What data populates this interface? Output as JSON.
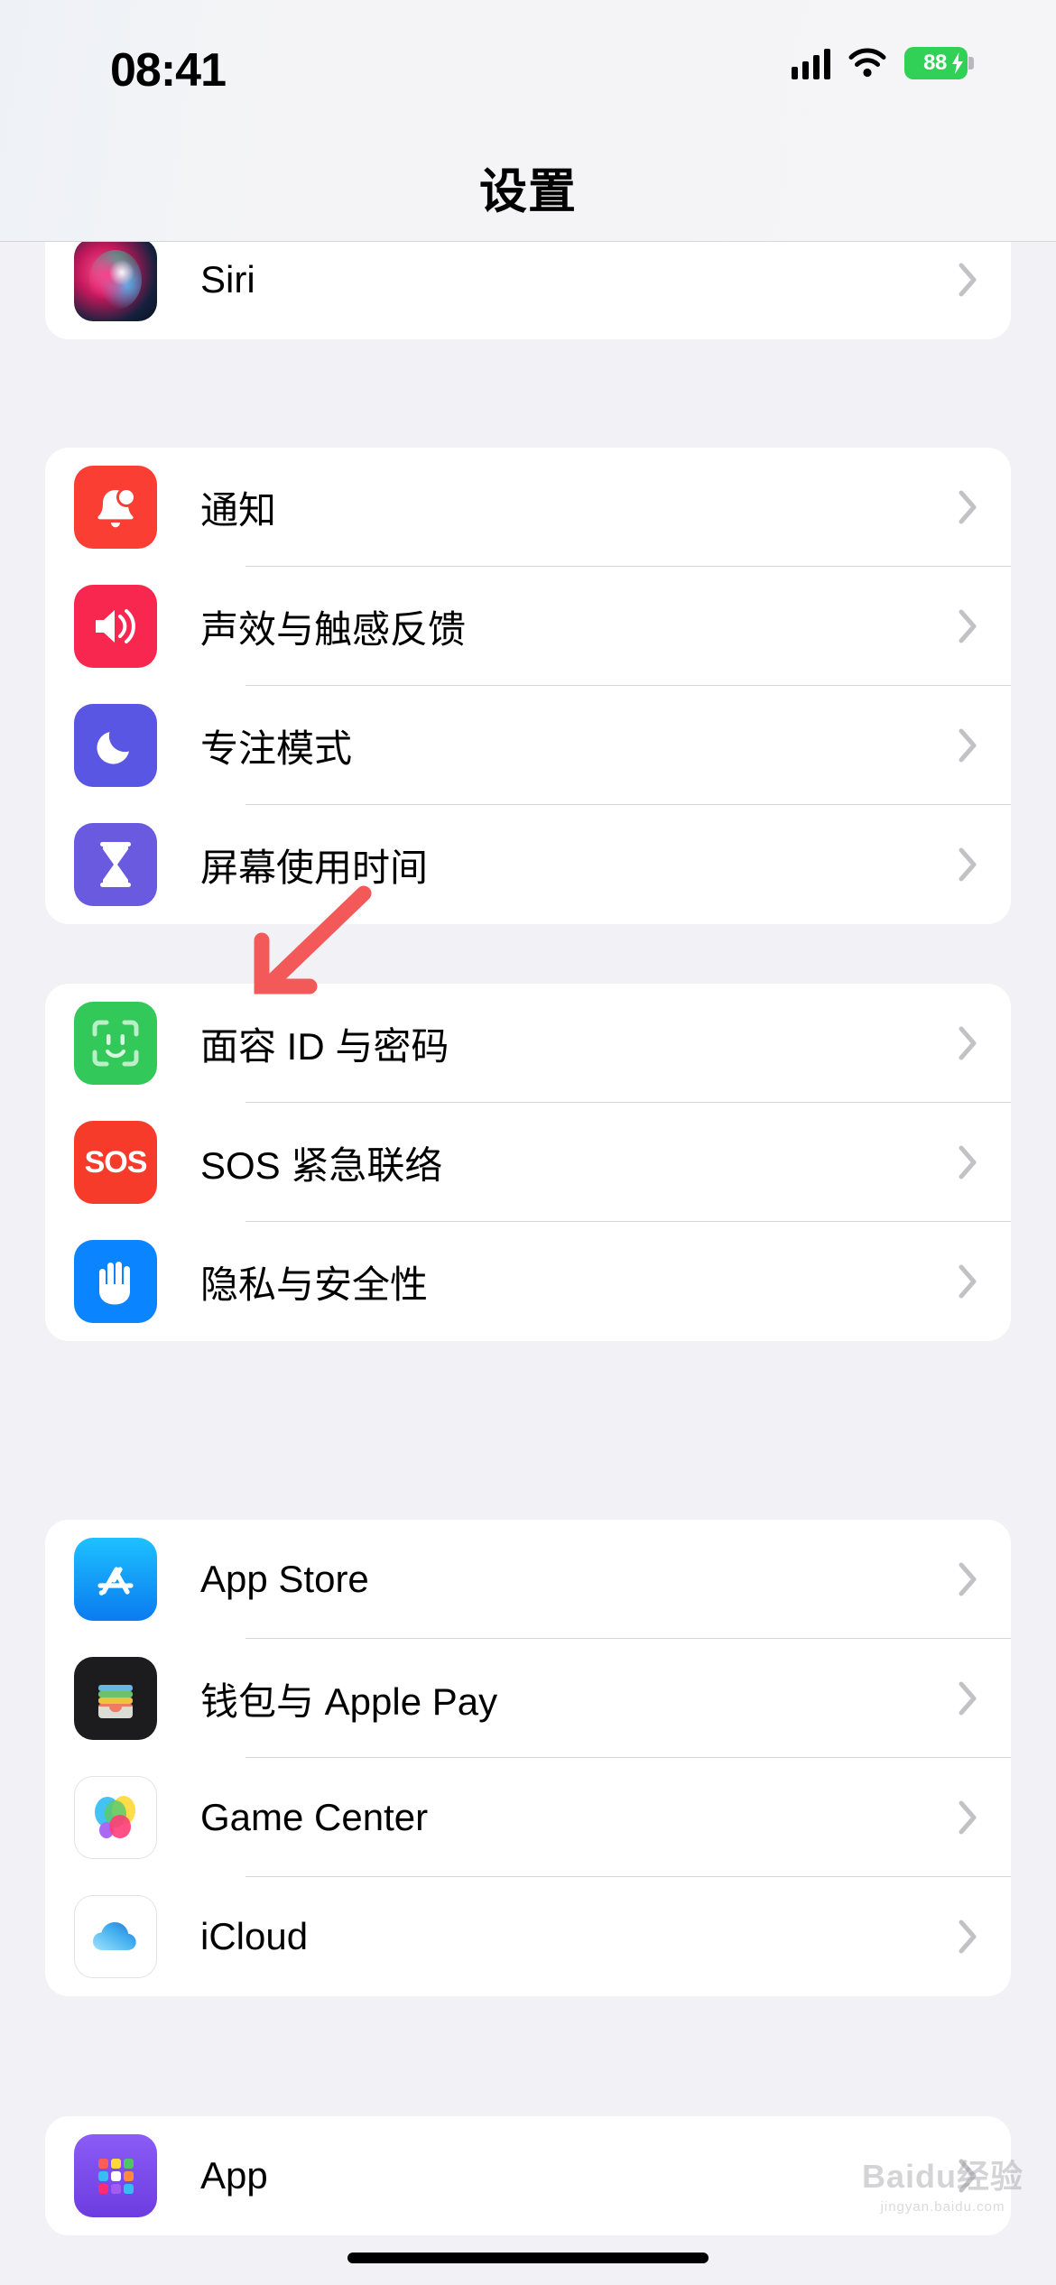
{
  "status_bar": {
    "time": "08:41",
    "battery_percent": "88",
    "battery_color": "#31d158",
    "icons": [
      "cellular-signal-icon",
      "wifi-icon",
      "battery-charging-icon"
    ]
  },
  "nav": {
    "title": "设置"
  },
  "groups": [
    {
      "id": "group-assistant",
      "rows": [
        {
          "label": "",
          "icon": "partial-top-row-icon",
          "icon_class": "ic-top",
          "partial": true
        },
        {
          "label": "Siri",
          "icon": "siri-icon",
          "icon_class": "ic-siri"
        }
      ]
    },
    {
      "id": "group-system",
      "rows": [
        {
          "label": "通知",
          "icon": "bell-icon",
          "icon_class": "ic-notif"
        },
        {
          "label": "声效与触感反馈",
          "icon": "speaker-icon",
          "icon_class": "ic-sound"
        },
        {
          "label": "专注模式",
          "icon": "moon-icon",
          "icon_class": "ic-focus"
        },
        {
          "label": "屏幕使用时间",
          "icon": "hourglass-icon",
          "icon_class": "ic-screen"
        }
      ]
    },
    {
      "id": "group-security",
      "rows": [
        {
          "label": "面容 ID 与密码",
          "icon": "face-id-icon",
          "icon_class": "ic-faceid"
        },
        {
          "label": "SOS 紧急联络",
          "icon": "sos-icon",
          "icon_class": "ic-sos"
        },
        {
          "label": "隐私与安全性",
          "icon": "hand-raised-icon",
          "icon_class": "ic-privacy"
        }
      ]
    },
    {
      "id": "group-services",
      "rows": [
        {
          "label": "App Store",
          "icon": "app-store-icon",
          "icon_class": "ic-appstore"
        },
        {
          "label": "钱包与 Apple Pay",
          "icon": "wallet-icon",
          "icon_class": "ic-wallet"
        },
        {
          "label": "Game Center",
          "icon": "game-center-icon",
          "icon_class": "ic-gamecenter"
        },
        {
          "label": "iCloud",
          "icon": "icloud-icon",
          "icon_class": "ic-icloud"
        }
      ]
    },
    {
      "id": "group-apps",
      "rows": [
        {
          "label": "App",
          "icon": "app-grid-icon",
          "icon_class": "ic-app"
        }
      ]
    }
  ],
  "annotation": {
    "type": "arrow",
    "color": "#f4595a",
    "points_to": "App Store"
  },
  "watermark": {
    "main": "Baidu经验",
    "sub": "jingyan.baidu.com"
  },
  "labels": {
    "siri": "Siri",
    "notifications": "通知",
    "sounds": "声效与触感反馈",
    "focus": "专注模式",
    "screen_time": "屏幕使用时间",
    "face_id": "面容 ID 与密码",
    "sos": "SOS 紧急联络",
    "privacy": "隐私与安全性",
    "app_store": "App Store",
    "wallet": "钱包与 Apple Pay",
    "game_center": "Game Center",
    "icloud": "iCloud",
    "app": "App",
    "sos_glyph": "SOS"
  }
}
